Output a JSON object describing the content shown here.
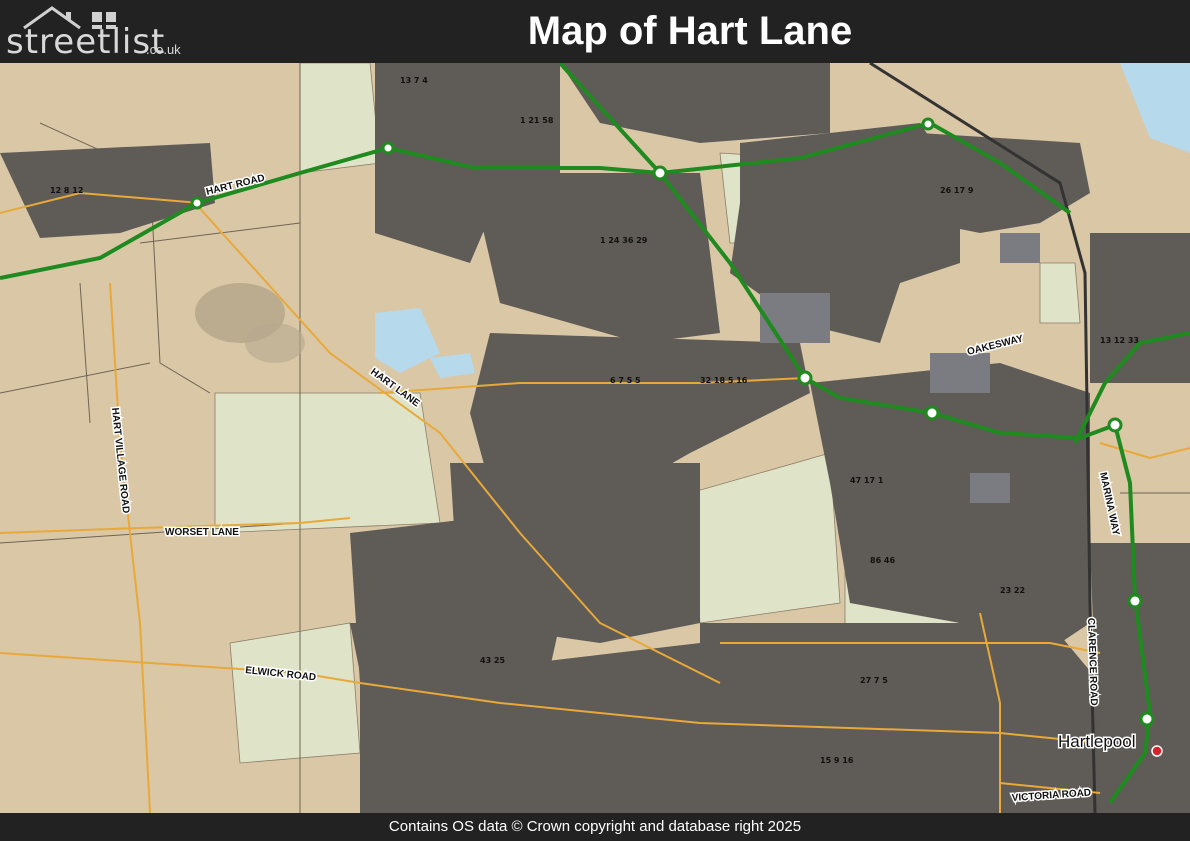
{
  "header": {
    "logo_main": "streetlist",
    "logo_suffix": ".co.uk",
    "title": "Map of Hart Lane"
  },
  "map": {
    "roads": {
      "hart_road": "HART ROAD",
      "hart_lane": "HART LANE",
      "hart_village_road": "HART VILLAGE ROAD",
      "worset_lane": "WORSET LANE",
      "elwick_road": "ELWICK ROAD",
      "oakesway": "OAKESWAY",
      "marina_way": "MARINA WAY",
      "clarence_road": "CLARENCE ROAD",
      "victoria_road": "VICTORIA ROAD"
    },
    "places": {
      "hartlepool": "Hartlepool"
    },
    "colors": {
      "land": "#d9c7a6",
      "field": "#d8e0c4",
      "urban": "#5a5a5a",
      "green_route": "#1f8a1f",
      "minor_road": "#e8a93a",
      "water": "#b6d9ec",
      "marker": "#d9212b"
    }
  },
  "footer": {
    "attribution": "Contains OS data © Crown copyright and database right 2025"
  }
}
